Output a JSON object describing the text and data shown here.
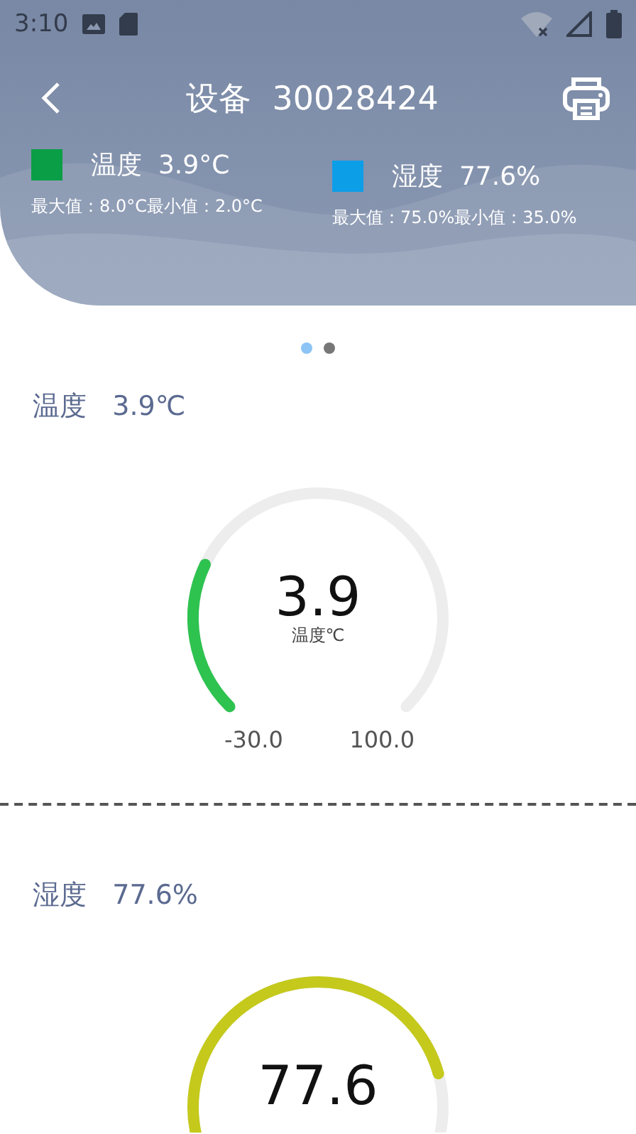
{
  "status_bar": {
    "time": "3:10"
  },
  "header": {
    "title": "设备  30028424"
  },
  "stats": [
    {
      "label": "温度",
      "value": "3.9°C",
      "color": "#0a9e46",
      "range": "最大值：8.0°C最小值：2.0°C"
    },
    {
      "label": "湿度",
      "value": "77.6%",
      "color": "#0d9ee8",
      "range": "最大值：75.0%最小值：35.0%"
    }
  ],
  "pager": [
    {
      "selected": true
    },
    {
      "selected": false
    }
  ],
  "gauges": [
    {
      "title": "温度",
      "reading": "3.9℃",
      "value": "3.9",
      "unit": "温度℃",
      "min": "-30.0",
      "max": "100.0",
      "color": "#2ec24f"
    },
    {
      "title": "湿度",
      "reading": "77.6%",
      "value": "77.6",
      "color": "#c4c91c"
    }
  ]
}
